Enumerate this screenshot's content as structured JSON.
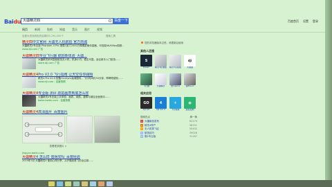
{
  "header": {
    "logo_text": "Bai",
    "logo_text_b": "du百度",
    "search_value": "大疆精灵四",
    "search_button": "百度一下",
    "top_links": [
      "百度首页",
      "设置",
      "登录"
    ]
  },
  "tabs": [
    "网页",
    "新闻",
    "贴吧",
    "知道",
    "音乐",
    "图片",
    "视频"
  ],
  "result_count": "百度为您找到相关结果约5,190,000个",
  "tools_label": "搜索工具",
  "results": [
    {
      "title_hl": "精灵四",
      "title": "中文官网_大疆无人机航拍 官方商城",
      "text": "大疆精灵4专业版 Phantom 4 Pro 搭载1英寸2000万像素影像传感器，可拍摄4K/60fps视频…",
      "url": "www.dji.com  广告"
    },
    {
      "title_hl": "大疆精灵四",
      "title": "专业飞行器 航拍新体验_大疆...",
      "text": "大疆精灵系列智能航拍无人机，机身小巧，稳定可靠，适合新手入门航拍……",
      "url": "store.dji.com  广告"
    },
    {
      "title_hl": "大疆精灵4",
      "title": "Pro V2.0 飞行指南 让天空任你翱翔",
      "text": "精灵4 Pro V2.0 配备OcuSync高清图传，飞行时间约30分钟，障碍物感知……",
      "url": "www.dji.com  - 百度快照"
    },
    {
      "title_hl": "大疆精灵4",
      "title": "专业版 测评 航拍画质到底怎么样",
      "text": "大疆精灵4专业版上手体验：画质、续航、避障与操控全面测评……",
      "url": "baike.baidu.com - 百度快照"
    },
    {
      "title_hl": "大疆精灵4",
      "title": "高清图片_百度图片",
      "text": "",
      "url": ""
    },
    {
      "title_hl": "大疆精灵",
      "title": "4 怎么样 值得买吗_百度经验",
      "text": "2019年3月 大疆精灵4 使用心得分享，从开箱到首飞的全过程……",
      "url": "jingyan.baidu.com"
    }
  ],
  "more_images": "查看更多图片 >",
  "right": {
    "notice": "您的浏览器版本过低，请更新后使用",
    "people_title": "其他人还搜",
    "people": [
      "Steam",
      "精灵3标准版",
      "精灵3高级版",
      "大疆御",
      "飞行器",
      "大疆精灵",
      "悟Inspire",
      "御Mavic"
    ],
    "apps_title": "相关应用",
    "apps": [
      "DJI GO",
      "DJI GO 4",
      "飞行模拟",
      "遥控控制"
    ],
    "hot_title": "搜索热点",
    "hot_right": "换一换",
    "hot": [
      {
        "t": "大疆新品发布",
        "v": "62175"
      },
      {
        "t": "精灵4停产",
        "v": "58741"
      },
      {
        "t": "无人机禁飞区",
        "v": "50432"
      },
      {
        "t": "航拍技巧",
        "v": "39026"
      },
      {
        "t": "御2专业版",
        "v": "31187"
      }
    ]
  },
  "colors": {
    "link": "#2440b3",
    "highlight": "#c00000",
    "url": "#1b8a3b",
    "brand": "#3a6fd6"
  }
}
